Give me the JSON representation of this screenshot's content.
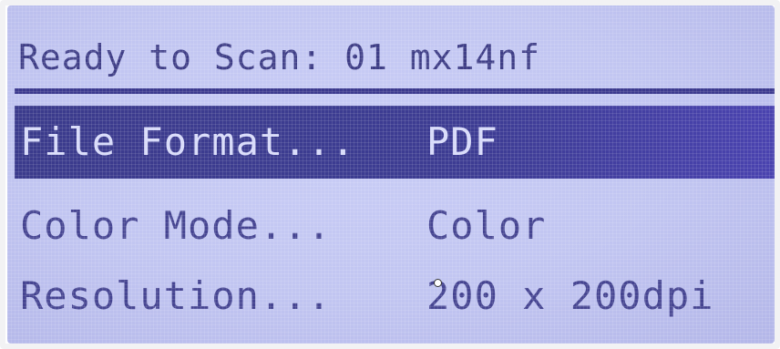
{
  "header": {
    "status": "Ready to Scan: 01 mx14nf"
  },
  "menu": {
    "items": [
      {
        "label": "File Format...",
        "value": "PDF",
        "selected": true
      },
      {
        "label": "Color Mode...",
        "value": "Color",
        "selected": false
      },
      {
        "label": "Resolution...",
        "value": "200 x 200dpi",
        "selected": false
      }
    ]
  },
  "colors": {
    "lcd_background": "#c1c5f1",
    "text": "#454491",
    "highlight": "#3b3b8c",
    "highlight_text": "#d8dbfa"
  }
}
